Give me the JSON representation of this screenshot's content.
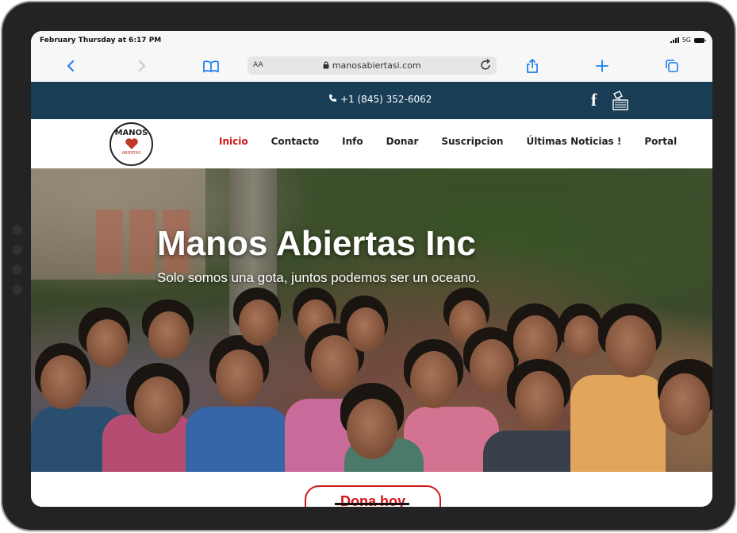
{
  "status_bar": {
    "time": "February Thursday at 6:17 PM",
    "network": "5G"
  },
  "browser": {
    "aa_label": "AA",
    "url": "manosabiertasi.com",
    "icons": [
      "back-icon",
      "forward-icon",
      "bookmarks-icon",
      "lock-icon",
      "reload-icon",
      "share-icon",
      "new-tab-icon",
      "tabs-icon"
    ]
  },
  "topbar": {
    "phone": "+1 (845) 352-6062",
    "social_icon": "f"
  },
  "logo": {
    "top": "MANOS",
    "bottom": "ABIERTAS"
  },
  "nav": {
    "items": [
      {
        "label": "Inicio",
        "active": true
      },
      {
        "label": "Contacto"
      },
      {
        "label": "Info"
      },
      {
        "label": "Donar"
      },
      {
        "label": "Suscripcion"
      },
      {
        "label": "Últimas Noticias !"
      },
      {
        "label": "Portal"
      }
    ]
  },
  "hero": {
    "title": "Manos Abiertas Inc",
    "subtitle": "Solo somos una gota, juntos podemos ser un oceano."
  },
  "cta": {
    "label": "Dona hoy"
  },
  "colors": {
    "accent": "#d01616",
    "topbar": "#1a3d56",
    "browser_blue": "#1a7cf2"
  }
}
